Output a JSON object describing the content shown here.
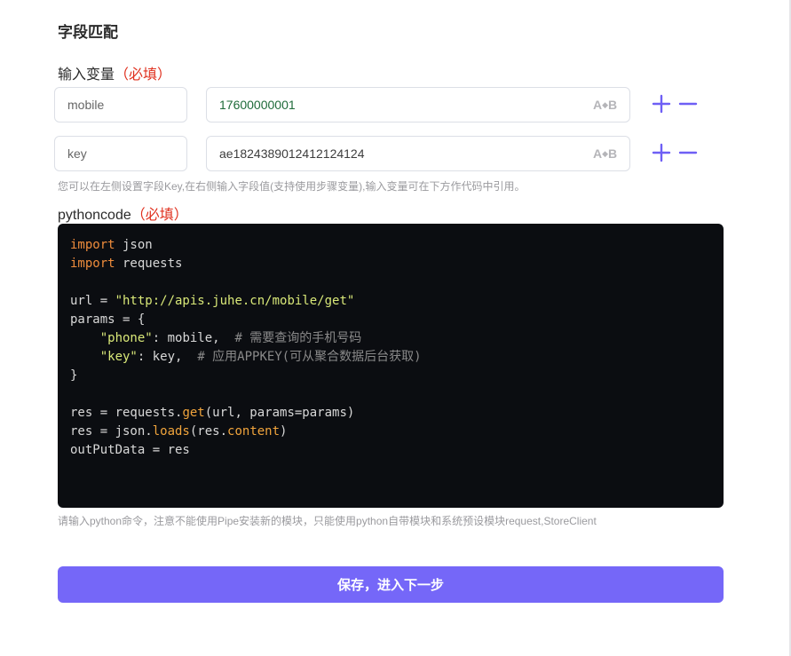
{
  "section": {
    "title": "字段匹配"
  },
  "input_vars": {
    "label": "输入变量",
    "required_tag": "（必填）",
    "rows": [
      {
        "key": "mobile",
        "value": "17600000001"
      },
      {
        "key": "key",
        "value": "ae1824389012412124124"
      }
    ],
    "toggle_label": "A+B",
    "hint": "您可以在左侧设置字段Key,在右侧输入字段值(支持使用步骤变量),输入变量可在下方作代码中引用。"
  },
  "code": {
    "label": "pythoncode",
    "required_tag": "（必填）",
    "lines": [
      [
        {
          "t": "kw",
          "v": "import"
        },
        {
          "t": "p",
          "v": " json"
        }
      ],
      [
        {
          "t": "kw",
          "v": "import"
        },
        {
          "t": "p",
          "v": " requests"
        }
      ],
      [],
      [
        {
          "t": "p",
          "v": "url = "
        },
        {
          "t": "str",
          "v": "\"http://apis.juhe.cn/mobile/get\""
        }
      ],
      [
        {
          "t": "p",
          "v": "params = {"
        }
      ],
      [
        {
          "t": "p",
          "v": "    "
        },
        {
          "t": "str",
          "v": "\"phone\""
        },
        {
          "t": "p",
          "v": ": mobile,  "
        },
        {
          "t": "cm",
          "v": "# 需要查询的手机号码"
        }
      ],
      [
        {
          "t": "p",
          "v": "    "
        },
        {
          "t": "str",
          "v": "\"key\""
        },
        {
          "t": "p",
          "v": ": key,  "
        },
        {
          "t": "cm",
          "v": "# 应用APPKEY(可从聚合数据后台获取)"
        }
      ],
      [
        {
          "t": "p",
          "v": "}"
        }
      ],
      [],
      [
        {
          "t": "p",
          "v": "res = requests."
        },
        {
          "t": "fn",
          "v": "get"
        },
        {
          "t": "p",
          "v": "(url, params=params)"
        }
      ],
      [
        {
          "t": "p",
          "v": "res = json."
        },
        {
          "t": "fn",
          "v": "loads"
        },
        {
          "t": "p",
          "v": "(res."
        },
        {
          "t": "fn",
          "v": "content"
        },
        {
          "t": "p",
          "v": ")"
        }
      ],
      [
        {
          "t": "p",
          "v": "outPutData = res"
        }
      ]
    ],
    "hint": "请输入python命令，注意不能使用Pipe安装新的模块，只能使用python自带模块和系统预设模块request,StoreClient"
  },
  "save_button": {
    "label": "保存，进入下一步"
  },
  "colors": {
    "accent": "#7567f8",
    "required": "#e0301e",
    "code_bg": "#0b0d11"
  }
}
